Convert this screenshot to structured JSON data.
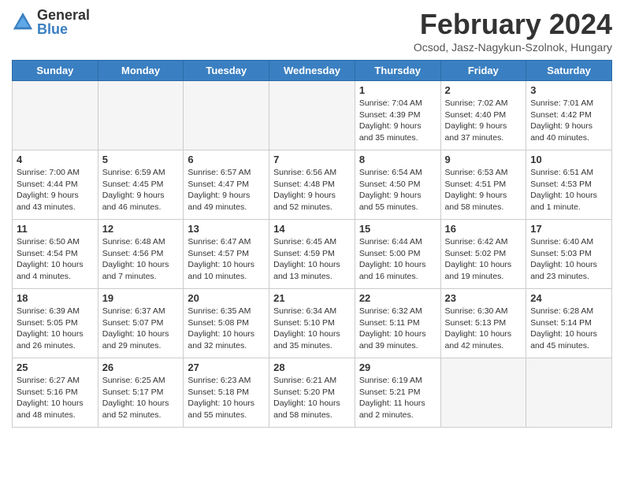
{
  "logo": {
    "general": "General",
    "blue": "Blue"
  },
  "title": "February 2024",
  "subtitle": "Ocsod, Jasz-Nagykun-Szolnok, Hungary",
  "headers": [
    "Sunday",
    "Monday",
    "Tuesday",
    "Wednesday",
    "Thursday",
    "Friday",
    "Saturday"
  ],
  "weeks": [
    [
      {
        "day": "",
        "sunrise": "",
        "sunset": "",
        "daylight": ""
      },
      {
        "day": "",
        "sunrise": "",
        "sunset": "",
        "daylight": ""
      },
      {
        "day": "",
        "sunrise": "",
        "sunset": "",
        "daylight": ""
      },
      {
        "day": "",
        "sunrise": "",
        "sunset": "",
        "daylight": ""
      },
      {
        "day": "1",
        "sunrise": "Sunrise: 7:04 AM",
        "sunset": "Sunset: 4:39 PM",
        "daylight": "Daylight: 9 hours and 35 minutes."
      },
      {
        "day": "2",
        "sunrise": "Sunrise: 7:02 AM",
        "sunset": "Sunset: 4:40 PM",
        "daylight": "Daylight: 9 hours and 37 minutes."
      },
      {
        "day": "3",
        "sunrise": "Sunrise: 7:01 AM",
        "sunset": "Sunset: 4:42 PM",
        "daylight": "Daylight: 9 hours and 40 minutes."
      }
    ],
    [
      {
        "day": "4",
        "sunrise": "Sunrise: 7:00 AM",
        "sunset": "Sunset: 4:44 PM",
        "daylight": "Daylight: 9 hours and 43 minutes."
      },
      {
        "day": "5",
        "sunrise": "Sunrise: 6:59 AM",
        "sunset": "Sunset: 4:45 PM",
        "daylight": "Daylight: 9 hours and 46 minutes."
      },
      {
        "day": "6",
        "sunrise": "Sunrise: 6:57 AM",
        "sunset": "Sunset: 4:47 PM",
        "daylight": "Daylight: 9 hours and 49 minutes."
      },
      {
        "day": "7",
        "sunrise": "Sunrise: 6:56 AM",
        "sunset": "Sunset: 4:48 PM",
        "daylight": "Daylight: 9 hours and 52 minutes."
      },
      {
        "day": "8",
        "sunrise": "Sunrise: 6:54 AM",
        "sunset": "Sunset: 4:50 PM",
        "daylight": "Daylight: 9 hours and 55 minutes."
      },
      {
        "day": "9",
        "sunrise": "Sunrise: 6:53 AM",
        "sunset": "Sunset: 4:51 PM",
        "daylight": "Daylight: 9 hours and 58 minutes."
      },
      {
        "day": "10",
        "sunrise": "Sunrise: 6:51 AM",
        "sunset": "Sunset: 4:53 PM",
        "daylight": "Daylight: 10 hours and 1 minute."
      }
    ],
    [
      {
        "day": "11",
        "sunrise": "Sunrise: 6:50 AM",
        "sunset": "Sunset: 4:54 PM",
        "daylight": "Daylight: 10 hours and 4 minutes."
      },
      {
        "day": "12",
        "sunrise": "Sunrise: 6:48 AM",
        "sunset": "Sunset: 4:56 PM",
        "daylight": "Daylight: 10 hours and 7 minutes."
      },
      {
        "day": "13",
        "sunrise": "Sunrise: 6:47 AM",
        "sunset": "Sunset: 4:57 PM",
        "daylight": "Daylight: 10 hours and 10 minutes."
      },
      {
        "day": "14",
        "sunrise": "Sunrise: 6:45 AM",
        "sunset": "Sunset: 4:59 PM",
        "daylight": "Daylight: 10 hours and 13 minutes."
      },
      {
        "day": "15",
        "sunrise": "Sunrise: 6:44 AM",
        "sunset": "Sunset: 5:00 PM",
        "daylight": "Daylight: 10 hours and 16 minutes."
      },
      {
        "day": "16",
        "sunrise": "Sunrise: 6:42 AM",
        "sunset": "Sunset: 5:02 PM",
        "daylight": "Daylight: 10 hours and 19 minutes."
      },
      {
        "day": "17",
        "sunrise": "Sunrise: 6:40 AM",
        "sunset": "Sunset: 5:03 PM",
        "daylight": "Daylight: 10 hours and 23 minutes."
      }
    ],
    [
      {
        "day": "18",
        "sunrise": "Sunrise: 6:39 AM",
        "sunset": "Sunset: 5:05 PM",
        "daylight": "Daylight: 10 hours and 26 minutes."
      },
      {
        "day": "19",
        "sunrise": "Sunrise: 6:37 AM",
        "sunset": "Sunset: 5:07 PM",
        "daylight": "Daylight: 10 hours and 29 minutes."
      },
      {
        "day": "20",
        "sunrise": "Sunrise: 6:35 AM",
        "sunset": "Sunset: 5:08 PM",
        "daylight": "Daylight: 10 hours and 32 minutes."
      },
      {
        "day": "21",
        "sunrise": "Sunrise: 6:34 AM",
        "sunset": "Sunset: 5:10 PM",
        "daylight": "Daylight: 10 hours and 35 minutes."
      },
      {
        "day": "22",
        "sunrise": "Sunrise: 6:32 AM",
        "sunset": "Sunset: 5:11 PM",
        "daylight": "Daylight: 10 hours and 39 minutes."
      },
      {
        "day": "23",
        "sunrise": "Sunrise: 6:30 AM",
        "sunset": "Sunset: 5:13 PM",
        "daylight": "Daylight: 10 hours and 42 minutes."
      },
      {
        "day": "24",
        "sunrise": "Sunrise: 6:28 AM",
        "sunset": "Sunset: 5:14 PM",
        "daylight": "Daylight: 10 hours and 45 minutes."
      }
    ],
    [
      {
        "day": "25",
        "sunrise": "Sunrise: 6:27 AM",
        "sunset": "Sunset: 5:16 PM",
        "daylight": "Daylight: 10 hours and 48 minutes."
      },
      {
        "day": "26",
        "sunrise": "Sunrise: 6:25 AM",
        "sunset": "Sunset: 5:17 PM",
        "daylight": "Daylight: 10 hours and 52 minutes."
      },
      {
        "day": "27",
        "sunrise": "Sunrise: 6:23 AM",
        "sunset": "Sunset: 5:18 PM",
        "daylight": "Daylight: 10 hours and 55 minutes."
      },
      {
        "day": "28",
        "sunrise": "Sunrise: 6:21 AM",
        "sunset": "Sunset: 5:20 PM",
        "daylight": "Daylight: 10 hours and 58 minutes."
      },
      {
        "day": "29",
        "sunrise": "Sunrise: 6:19 AM",
        "sunset": "Sunset: 5:21 PM",
        "daylight": "Daylight: 11 hours and 2 minutes."
      },
      {
        "day": "",
        "sunrise": "",
        "sunset": "",
        "daylight": ""
      },
      {
        "day": "",
        "sunrise": "",
        "sunset": "",
        "daylight": ""
      }
    ]
  ]
}
